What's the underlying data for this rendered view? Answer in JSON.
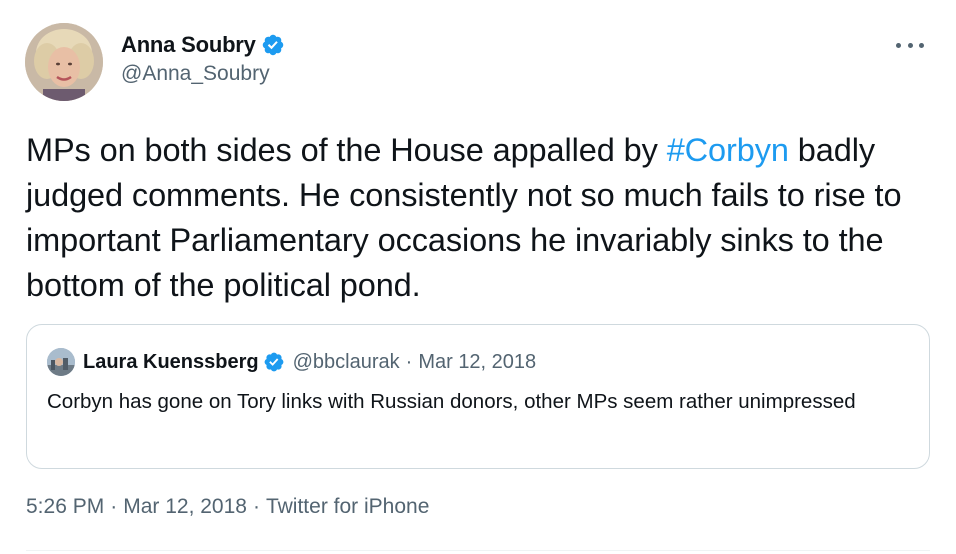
{
  "author": {
    "name": "Anna Soubry",
    "handle": "@Anna_Soubry",
    "verified": true
  },
  "tweet": {
    "text_before": "MPs on both sides of the House appalled by ",
    "hashtag": "#Corbyn",
    "text_after": " badly judged comments. He consistently not so much fails to rise to important Parliamentary occasions he invariably sinks to the bottom of the political pond."
  },
  "quote": {
    "name": "Laura Kuenssberg",
    "handle": "@bbclaurak",
    "separator": "·",
    "date": "Mar 12, 2018",
    "verified": true,
    "text": "Corbyn has gone on Tory links with Russian donors, other MPs seem rather unimpressed"
  },
  "meta": {
    "time": "5:26 PM",
    "date": "Mar 12, 2018",
    "source": "Twitter for iPhone",
    "separator": "·"
  },
  "colors": {
    "accent": "#1d9bf0",
    "secondary_text": "#536471",
    "primary_text": "#0f1419",
    "border": "#cfd9de"
  },
  "icons": {
    "more": "more-horizontal-icon",
    "verified": "verified-badge-icon"
  }
}
